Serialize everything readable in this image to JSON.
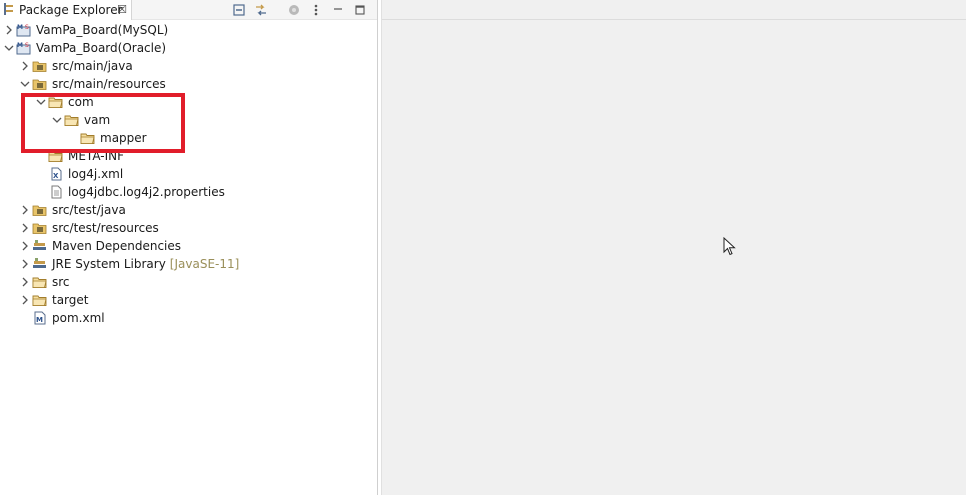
{
  "package_explorer": {
    "title": "Package Explorer",
    "close_glyph": "☒"
  },
  "tree": [
    {
      "label": "VamPa_Board(MySQL)",
      "level": 0,
      "expanded": false,
      "icon": "maven-project-icon"
    },
    {
      "label": "VamPa_Board(Oracle)",
      "level": 0,
      "expanded": true,
      "icon": "maven-project-icon"
    },
    {
      "label": "src/main/java",
      "level": 1,
      "expanded": false,
      "icon": "source-folder-icon"
    },
    {
      "label": "src/main/resources",
      "level": 1,
      "expanded": true,
      "icon": "source-folder-icon"
    },
    {
      "label": "com",
      "level": 2,
      "expanded": true,
      "icon": "folder-icon"
    },
    {
      "label": "vam",
      "level": 3,
      "expanded": true,
      "icon": "folder-icon"
    },
    {
      "label": "mapper",
      "level": 4,
      "expanded": null,
      "icon": "folder-icon"
    },
    {
      "label": "META-INF",
      "level": 2,
      "expanded": null,
      "icon": "folder-icon"
    },
    {
      "label": "log4j.xml",
      "level": 2,
      "expanded": null,
      "icon": "xml-file-icon"
    },
    {
      "label": "log4jdbc.log4j2.properties",
      "level": 2,
      "expanded": null,
      "icon": "text-file-icon"
    },
    {
      "label": "src/test/java",
      "level": 1,
      "expanded": false,
      "icon": "source-folder-icon"
    },
    {
      "label": "src/test/resources",
      "level": 1,
      "expanded": false,
      "icon": "source-folder-icon"
    },
    {
      "label": "Maven Dependencies",
      "level": 1,
      "expanded": false,
      "icon": "library-icon"
    },
    {
      "label": "JRE System Library",
      "level": 1,
      "expanded": false,
      "icon": "library-icon",
      "decoration": "[JavaSE-11]"
    },
    {
      "label": "src",
      "level": 1,
      "expanded": false,
      "icon": "folder-icon"
    },
    {
      "label": "target",
      "level": 1,
      "expanded": false,
      "icon": "folder-icon"
    },
    {
      "label": "pom.xml",
      "level": 1,
      "expanded": null,
      "icon": "maven-pom-icon"
    }
  ],
  "colors": {
    "highlight": "#e11d2a",
    "folder": "#e8c46a",
    "decoration": "#9a8f5a"
  }
}
